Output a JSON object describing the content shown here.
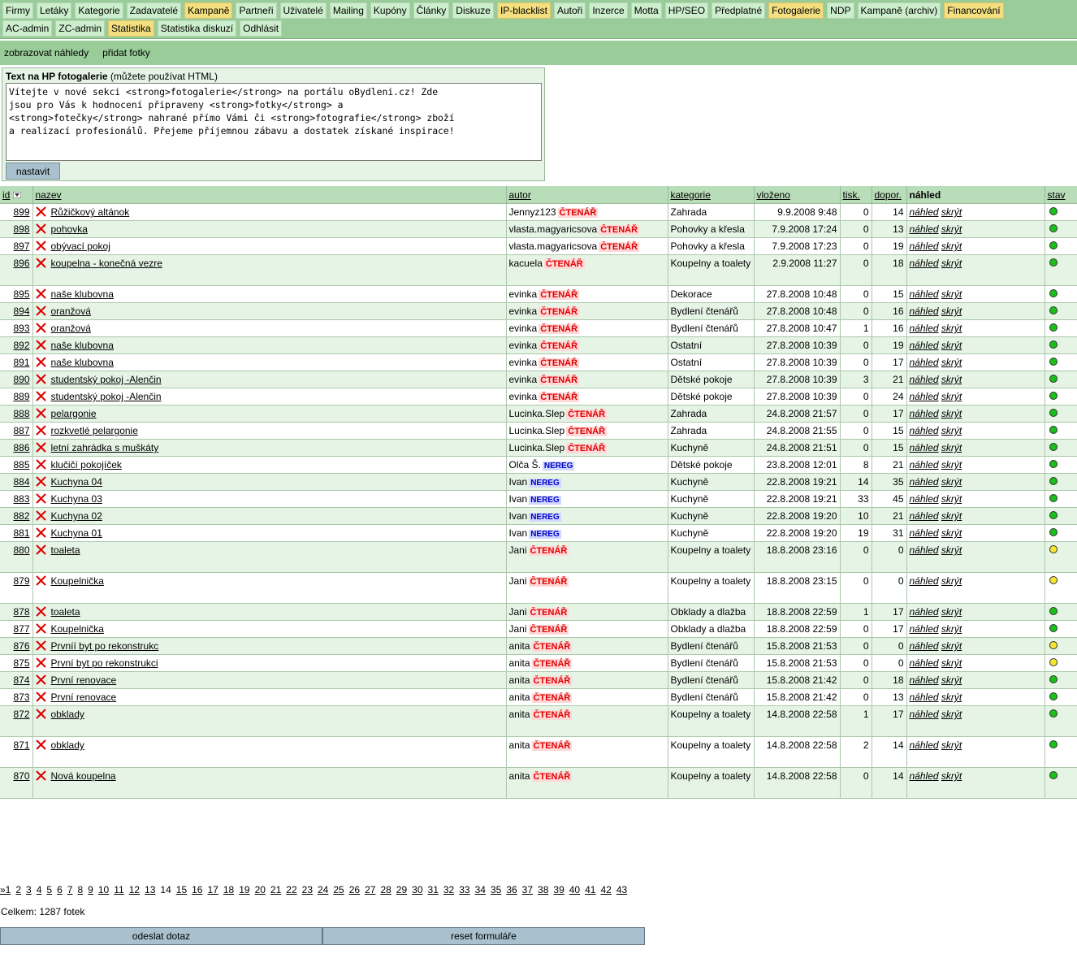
{
  "nav": {
    "row1": [
      {
        "label": "Firmy",
        "hl": false
      },
      {
        "label": "Letáky",
        "hl": false
      },
      {
        "label": "Kategorie",
        "hl": false
      },
      {
        "label": "Zadavatelé",
        "hl": false
      },
      {
        "label": "Kampaně",
        "hl": true
      },
      {
        "label": "Partneři",
        "hl": false
      },
      {
        "label": "Uživatelé",
        "hl": false
      },
      {
        "label": "Mailing",
        "hl": false
      },
      {
        "label": "Kupóny",
        "hl": false
      },
      {
        "label": "Články",
        "hl": false
      },
      {
        "label": "Diskuze",
        "hl": false
      },
      {
        "label": "IP-blacklist",
        "hl": true
      },
      {
        "label": "Autoři",
        "hl": false
      },
      {
        "label": "Inzerce",
        "hl": false
      },
      {
        "label": "Motta",
        "hl": false
      },
      {
        "label": "HP/SEO",
        "hl": false
      },
      {
        "label": "Předplatné",
        "hl": false
      },
      {
        "label": "Fotogalerie",
        "hl": true
      },
      {
        "label": "NDP",
        "hl": false
      },
      {
        "label": "Kampaně (archiv)",
        "hl": false
      },
      {
        "label": "Financování",
        "hl": true
      }
    ],
    "row2": [
      {
        "label": "AC-admin",
        "hl": false
      },
      {
        "label": "ZC-admin",
        "hl": false
      },
      {
        "label": "Statistika",
        "hl": true
      },
      {
        "label": "Statistika diskuzí",
        "hl": false
      },
      {
        "label": "Odhlásit",
        "hl": false
      }
    ]
  },
  "subnav": [
    "zobrazovat náhledy",
    "přidat fotky"
  ],
  "hp_text": {
    "label_bold": "Text na HP fotogalerie",
    "label_rest": " (můžete používat HTML)",
    "value": "Vítejte v nové sekci <strong>fotogalerie</strong> na portálu oBydleni.cz! Zde\njsou pro Vás k hodnocení připraveny <strong>fotky</strong> a\n<strong>fotečky</strong> nahrané přímo Vámi či <strong>fotografie</strong> zboží\na realizací profesionálů. Přejeme příjemnou zábavu a dostatek získané inspirace!",
    "button": "nastavit"
  },
  "table": {
    "headers": {
      "id": "id",
      "sort_icon": "sort-desc-icon",
      "nazev": "nazev",
      "autor": "autor",
      "kategorie": "kategorie",
      "vlozeno": "vloženo",
      "tisk": "tisk.",
      "dopor": "dopor.",
      "nahled": "náhled",
      "stav": "stav"
    },
    "preview_label": "náhled",
    "hide_label": "skrýt",
    "rows": [
      {
        "id": "899",
        "title": "Růžičkový altánok",
        "author": "Jennyz123",
        "badge": "ČTENÁŘ",
        "cat": "Zahrada",
        "date": "9.9.2008 9:48",
        "tisk": "0",
        "dopor": "14",
        "stav": "green"
      },
      {
        "id": "898",
        "title": "pohovka",
        "author": "vlasta.magyaricsova",
        "badge": "ČTENÁŘ",
        "cat": "Pohovky a křesla",
        "date": "7.9.2008 17:24",
        "tisk": "0",
        "dopor": "13",
        "stav": "green"
      },
      {
        "id": "897",
        "title": "obývací pokoj",
        "author": "vlasta.magyaricsova",
        "badge": "ČTENÁŘ",
        "cat": "Pohovky a křesla",
        "date": "7.9.2008 17:23",
        "tisk": "0",
        "dopor": "19",
        "stav": "green"
      },
      {
        "id": "896",
        "title": "koupelna - konečná vezre",
        "author": "kacuela",
        "badge": "ČTENÁŘ",
        "cat": "Koupelny a toalety",
        "date": "2.9.2008 11:27",
        "tisk": "0",
        "dopor": "18",
        "stav": "green",
        "tall": true
      },
      {
        "id": "895",
        "title": "naše klubovna",
        "author": "evinka",
        "badge": "ČTENÁŘ",
        "cat": "Dekorace",
        "date": "27.8.2008 10:48",
        "tisk": "0",
        "dopor": "15",
        "stav": "green"
      },
      {
        "id": "894",
        "title": "oranžová",
        "author": "evinka",
        "badge": "ČTENÁŘ",
        "cat": "Bydlení čtenářů",
        "date": "27.8.2008 10:48",
        "tisk": "0",
        "dopor": "16",
        "stav": "green"
      },
      {
        "id": "893",
        "title": "oranžová",
        "author": "evinka",
        "badge": "ČTENÁŘ",
        "cat": "Bydlení čtenářů",
        "date": "27.8.2008 10:47",
        "tisk": "1",
        "dopor": "16",
        "stav": "green"
      },
      {
        "id": "892",
        "title": "naše klubovna",
        "author": "evinka",
        "badge": "ČTENÁŘ",
        "cat": "Ostatní",
        "date": "27.8.2008 10:39",
        "tisk": "0",
        "dopor": "19",
        "stav": "green"
      },
      {
        "id": "891",
        "title": "naše klubovna",
        "author": "evinka",
        "badge": "ČTENÁŘ",
        "cat": "Ostatní",
        "date": "27.8.2008 10:39",
        "tisk": "0",
        "dopor": "17",
        "stav": "green"
      },
      {
        "id": "890",
        "title": "studentský pokoj -Alenčin",
        "author": "evinka",
        "badge": "ČTENÁŘ",
        "cat": "Dětské pokoje",
        "date": "27.8.2008 10:39",
        "tisk": "3",
        "dopor": "21",
        "stav": "green"
      },
      {
        "id": "889",
        "title": "studentský pokoj -Alenčin",
        "author": "evinka",
        "badge": "ČTENÁŘ",
        "cat": "Dětské pokoje",
        "date": "27.8.2008 10:39",
        "tisk": "0",
        "dopor": "24",
        "stav": "green"
      },
      {
        "id": "888",
        "title": "pelargonie",
        "author": "Lucinka.Slep",
        "badge": "ČTENÁŘ",
        "cat": "Zahrada",
        "date": "24.8.2008 21:57",
        "tisk": "0",
        "dopor": "17",
        "stav": "green"
      },
      {
        "id": "887",
        "title": "rozkvetlé pelargonie",
        "author": "Lucinka.Slep",
        "badge": "ČTENÁŘ",
        "cat": "Zahrada",
        "date": "24.8.2008 21:55",
        "tisk": "0",
        "dopor": "15",
        "stav": "green"
      },
      {
        "id": "886",
        "title": "letní zahrádka s muškáty",
        "author": "Lucinka.Slep",
        "badge": "ČTENÁŘ",
        "cat": "Kuchyně",
        "date": "24.8.2008 21:51",
        "tisk": "0",
        "dopor": "15",
        "stav": "green"
      },
      {
        "id": "885",
        "title": "klučičí pokojíček",
        "author": "Olča Š.",
        "badge": "NEREG",
        "cat": "Dětské pokoje",
        "date": "23.8.2008 12:01",
        "tisk": "8",
        "dopor": "21",
        "stav": "green"
      },
      {
        "id": "884",
        "title": "Kuchyna 04",
        "author": "Ivan",
        "badge": "NEREG",
        "cat": "Kuchyně",
        "date": "22.8.2008 19:21",
        "tisk": "14",
        "dopor": "35",
        "stav": "green"
      },
      {
        "id": "883",
        "title": "Kuchyna 03",
        "author": "Ivan",
        "badge": "NEREG",
        "cat": "Kuchyně",
        "date": "22.8.2008 19:21",
        "tisk": "33",
        "dopor": "45",
        "stav": "green"
      },
      {
        "id": "882",
        "title": "Kuchyna 02",
        "author": "Ivan",
        "badge": "NEREG",
        "cat": "Kuchyně",
        "date": "22.8.2008 19:20",
        "tisk": "10",
        "dopor": "21",
        "stav": "green"
      },
      {
        "id": "881",
        "title": "Kuchyna 01",
        "author": "Ivan",
        "badge": "NEREG",
        "cat": "Kuchyně",
        "date": "22.8.2008 19:20",
        "tisk": "19",
        "dopor": "31",
        "stav": "green"
      },
      {
        "id": "880",
        "title": "toaleta",
        "author": "Jani",
        "badge": "ČTENÁŘ",
        "cat": "Koupelny a toalety",
        "date": "18.8.2008 23:16",
        "tisk": "0",
        "dopor": "0",
        "stav": "yellow",
        "tall": true
      },
      {
        "id": "879",
        "title": "Koupelnička",
        "author": "Jani",
        "badge": "ČTENÁŘ",
        "cat": "Koupelny a toalety",
        "date": "18.8.2008 23:15",
        "tisk": "0",
        "dopor": "0",
        "stav": "yellow",
        "tall": true
      },
      {
        "id": "878",
        "title": "toaleta",
        "author": "Jani",
        "badge": "ČTENÁŘ",
        "cat": "Obklady a dlažba",
        "date": "18.8.2008 22:59",
        "tisk": "1",
        "dopor": "17",
        "stav": "green"
      },
      {
        "id": "877",
        "title": "Koupelnička",
        "author": "Jani",
        "badge": "ČTENÁŘ",
        "cat": "Obklady a dlažba",
        "date": "18.8.2008 22:59",
        "tisk": "0",
        "dopor": "17",
        "stav": "green"
      },
      {
        "id": "876",
        "title": "Prvníí byt po rekonstrukc",
        "author": "anita",
        "badge": "ČTENÁŘ",
        "cat": "Bydlení čtenářů",
        "date": "15.8.2008 21:53",
        "tisk": "0",
        "dopor": "0",
        "stav": "yellow"
      },
      {
        "id": "875",
        "title": "První byt po rekonstrukci",
        "author": "anita",
        "badge": "ČTENÁŘ",
        "cat": "Bydlení čtenářů",
        "date": "15.8.2008 21:53",
        "tisk": "0",
        "dopor": "0",
        "stav": "yellow"
      },
      {
        "id": "874",
        "title": "První renovace",
        "author": "anita",
        "badge": "ČTENÁŘ",
        "cat": "Bydlení čtenářů",
        "date": "15.8.2008 21:42",
        "tisk": "0",
        "dopor": "18",
        "stav": "green"
      },
      {
        "id": "873",
        "title": "První renovace",
        "author": "anita",
        "badge": "ČTENÁŘ",
        "cat": "Bydlení čtenářů",
        "date": "15.8.2008 21:42",
        "tisk": "0",
        "dopor": "13",
        "stav": "green"
      },
      {
        "id": "872",
        "title": "obklady",
        "author": "anita",
        "badge": "ČTENÁŘ",
        "cat": "Koupelny a toalety",
        "date": "14.8.2008 22:58",
        "tisk": "1",
        "dopor": "17",
        "stav": "green",
        "tall": true
      },
      {
        "id": "871",
        "title": "obklady",
        "author": "anita",
        "badge": "ČTENÁŘ",
        "cat": "Koupelny a toalety",
        "date": "14.8.2008 22:58",
        "tisk": "2",
        "dopor": "14",
        "stav": "green",
        "tall": true
      },
      {
        "id": "870",
        "title": "Nová koupelna",
        "author": "anita",
        "badge": "ČTENÁŘ",
        "cat": "Koupelny a toalety",
        "date": "14.8.2008 22:58",
        "tisk": "0",
        "dopor": "14",
        "stav": "green",
        "tall": true
      }
    ]
  },
  "pager": {
    "first": "»1",
    "pages": [
      "2",
      "3",
      "4",
      "5",
      "6",
      "7",
      "8",
      "9",
      "10",
      "11",
      "12",
      "13",
      "14",
      "15",
      "16",
      "17",
      "18",
      "19",
      "20",
      "21",
      "22",
      "23",
      "24",
      "25",
      "26",
      "27",
      "28",
      "29",
      "30",
      "31",
      "32",
      "33",
      "34",
      "35",
      "36",
      "37",
      "38",
      "39",
      "40",
      "41",
      "42",
      "43"
    ],
    "current": "14"
  },
  "total": "Celkem: 1287 fotek",
  "form": {
    "submit": "odeslat dotaz",
    "reset": "reset formuláře"
  },
  "colors": {
    "nav_bg": "#99cc99",
    "nav_btn": "#cceecc",
    "nav_highlight": "#f3df7f",
    "row_alt": "#e6f4e6",
    "header_bg": "#b8ddb8",
    "delete_x": "#dd0000",
    "badge_reader": "#e00000",
    "badge_unreg": "#0000c0",
    "status_green": "#18c018",
    "status_yellow": "#f5e633"
  }
}
